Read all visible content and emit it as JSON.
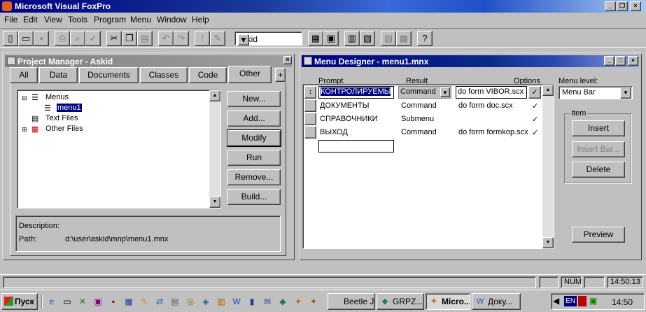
{
  "app": {
    "title": "Microsoft Visual FoxPro",
    "controls": [
      "_",
      "❐",
      "×"
    ]
  },
  "menubar": [
    "File",
    "Edit",
    "View",
    "Tools",
    "Program",
    "Menu",
    "Window",
    "Help"
  ],
  "toolbar": {
    "combo_value": "askid",
    "icons": [
      "new-icon",
      "open-icon",
      "save-icon",
      "print-icon",
      "print-preview-icon",
      "spell-check-icon",
      "cut-icon",
      "copy-icon",
      "paste-icon",
      "undo-icon",
      "redo-icon",
      "run-icon",
      "modify-icon",
      "command-window-icon",
      "data-session-icon",
      "form-wizard-icon",
      "report-wizard-icon",
      "autoform-icon",
      "autoreport-icon",
      "help-icon"
    ]
  },
  "project_manager": {
    "title": "Project Manager - Askid",
    "tabs": [
      "All",
      "Data",
      "Documents",
      "Classes",
      "Code",
      "Other"
    ],
    "expand_button": "+",
    "tree": {
      "menus": "Menus",
      "menu1": "menu1",
      "text_files": "Text Files",
      "other_files": "Other Files"
    },
    "buttons": [
      "New...",
      "Add...",
      "Modify",
      "Run",
      "Remove...",
      "Build..."
    ],
    "description_label": "Description:",
    "path_label": "Path:",
    "path_value": "d:\\user\\askid\\mnp\\menu1.mnx"
  },
  "menu_designer": {
    "title": "Menu Designer - menu1.mnx",
    "headers": {
      "prompt": "Prompt",
      "result": "Result",
      "options": "Options"
    },
    "rows": [
      {
        "prompt": "КОНТРОЛИРУЕМЫ",
        "result": "Command",
        "command": "do form VIBOR.scx",
        "option": "✓"
      },
      {
        "prompt": "ДОКУМЕНТЫ",
        "result": "Command",
        "command": "do form doc.scx",
        "option": "✓"
      },
      {
        "prompt": "СПРАВОЧНИКИ",
        "result": "Submenu",
        "command": "",
        "option": "✓"
      },
      {
        "prompt": "ВЫХОД",
        "result": "Command",
        "command": "do form formkop.scx",
        "option": "✓"
      }
    ],
    "menu_level_label": "Menu level:",
    "menu_level_value": "Menu Bar",
    "item_group_label": "Item",
    "insert_button": "Insert",
    "insert_bar_button": "Insert Bar...",
    "delete_button": "Delete",
    "preview_button": "Preview"
  },
  "statusbar": {
    "num": "NUM",
    "time": "14:50:13"
  },
  "taskbar": {
    "start": "Пуск",
    "tasks": [
      "Beetle Ju ...",
      "GRPZ...",
      "Micro...",
      "Доку..."
    ],
    "lang": "EN",
    "clock": "14:50"
  }
}
